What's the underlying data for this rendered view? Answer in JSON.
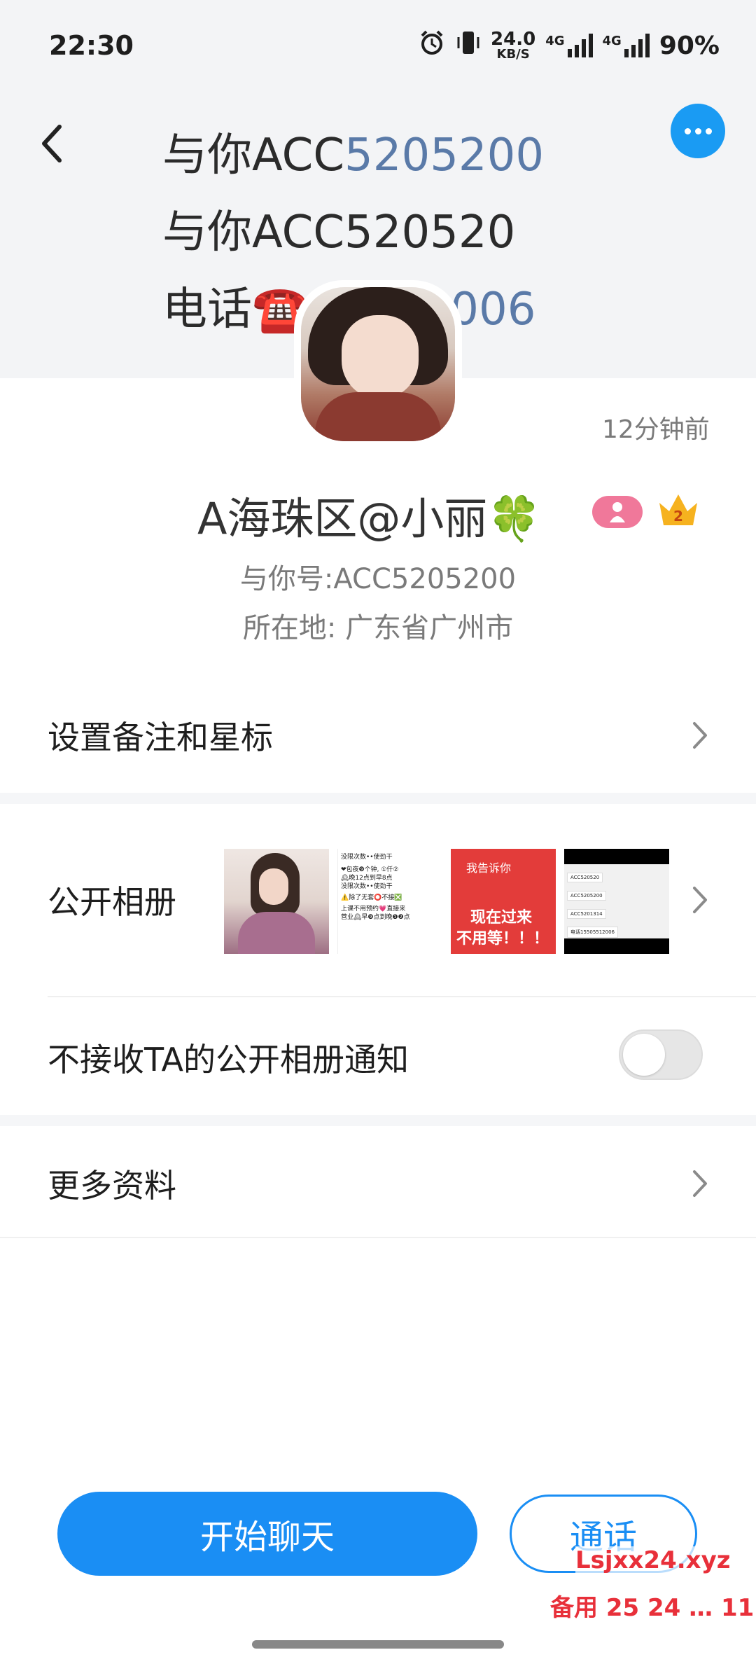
{
  "status_bar": {
    "time": "22:30",
    "net_speed": "24.0",
    "net_speed_unit": "KB/S",
    "net1": "4G",
    "net2": "4G",
    "battery": "90%"
  },
  "header": {
    "cover_text": {
      "line1_prefix": "与你ACC",
      "line1_highlight": "5205200",
      "line2": "与你ACC520520",
      "line3_prefix": "电话☎️1",
      "line3_highlight": "5512006"
    }
  },
  "profile": {
    "timestamp": "12分钟前",
    "name": "A海珠区@小丽🍀",
    "level_badge": "2",
    "account_id": "与你号:ACC5205200",
    "location": "所在地: 广东省广州市"
  },
  "rows": {
    "remark_label": "设置备注和星标",
    "album_label": "公开相册",
    "notify_label": "不接收TA的公开相册通知",
    "notify_enabled": false,
    "more_label": "更多资料"
  },
  "album_thumbs": {
    "t2_lines": [
      "没限次数••使劲干",
      "❤包夜❾个钟, ①仟②",
      "🕰晚12点到早8点",
      "没限次数••使劲干",
      "⚠️除了无套⭕不接❎",
      "上课不用预约💗直接来",
      "营业🕰早❾点到晚❶❷点"
    ],
    "t3_top": "我告诉你",
    "t3_mid": "现在过来",
    "t3_bot": "不用等！！！",
    "t4_chips": [
      "ACC520520",
      "ACC5205200",
      "ACC5201314",
      "电话15505512006"
    ]
  },
  "buttons": {
    "chat": "开始聊天",
    "call": "通话"
  },
  "watermark": {
    "line1": "Lsjxx24.xyz",
    "line2": "备用 25 24 … 11"
  },
  "colors": {
    "accent": "#1a8ef4",
    "header_bg": "#f3f4f6",
    "watermark": "#e8303a"
  }
}
